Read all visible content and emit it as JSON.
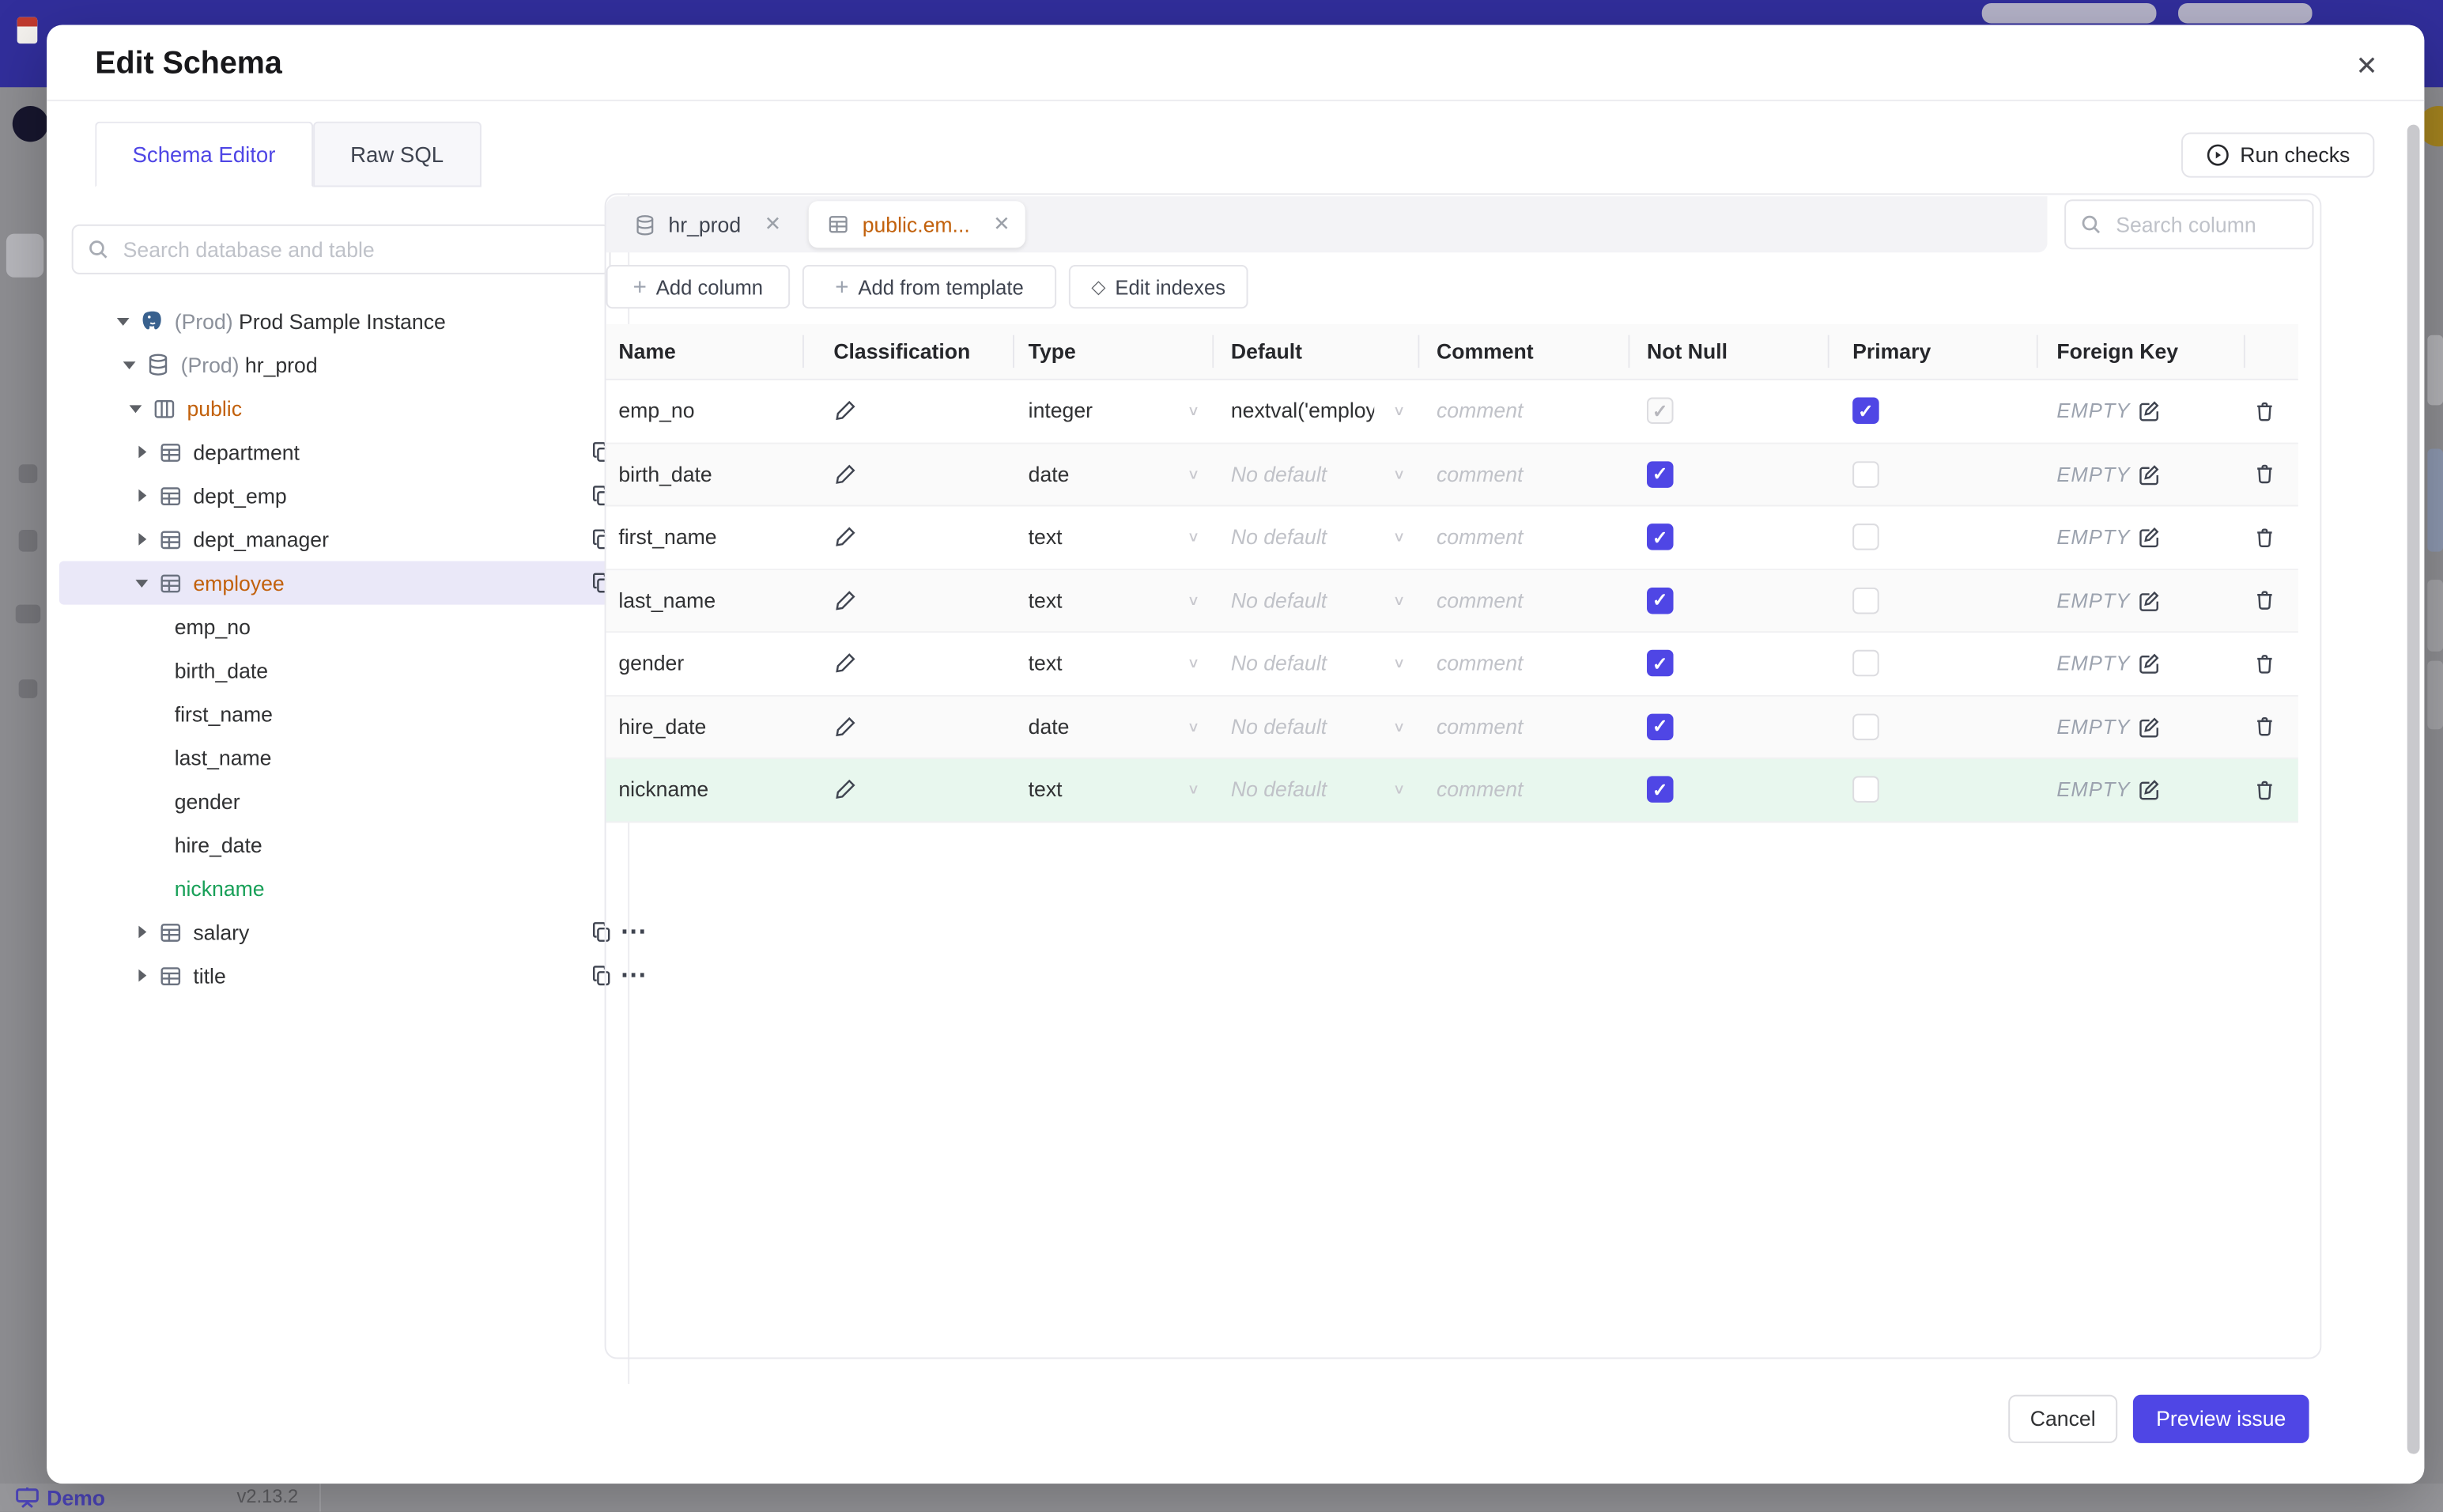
{
  "backdrop": {
    "footer": {
      "brand": "Demo",
      "version": "v2.13.2"
    }
  },
  "modal": {
    "title": "Edit Schema",
    "close_glyph": "✕",
    "run_checks_label": "Run checks",
    "tabs": [
      {
        "label": "Schema Editor",
        "tab_class": "active"
      },
      {
        "label": "Raw SQL",
        "tab_class": ""
      }
    ],
    "sidebar": {
      "search_placeholder": "Search database and table",
      "tree": [
        {
          "level": 0,
          "caret": "down",
          "icon": "elephant",
          "muted": "(Prod) ",
          "label": "Prod Sample Instance",
          "row_class": "",
          "label_class": "",
          "copy": false,
          "dots": false
        },
        {
          "level": 1,
          "caret": "down",
          "icon": "db",
          "muted": "(Prod) ",
          "label": "hr_prod",
          "row_class": "",
          "label_class": "",
          "copy": false,
          "dots": true
        },
        {
          "level": 2,
          "caret": "down",
          "icon": "schema",
          "muted": "",
          "label": "public",
          "row_class": "",
          "label_class": "amber",
          "copy": false,
          "dots": true
        },
        {
          "level": 3,
          "caret": "right",
          "icon": "table",
          "muted": "",
          "label": "department",
          "row_class": "",
          "label_class": "",
          "copy": true,
          "dots": true
        },
        {
          "level": 3,
          "caret": "right",
          "icon": "table",
          "muted": "",
          "label": "dept_emp",
          "row_class": "",
          "label_class": "",
          "copy": true,
          "dots": true
        },
        {
          "level": 3,
          "caret": "right",
          "icon": "table",
          "muted": "",
          "label": "dept_manager",
          "row_class": "",
          "label_class": "",
          "copy": true,
          "dots": true
        },
        {
          "level": 3,
          "caret": "down",
          "icon": "table",
          "muted": "",
          "label": "employee",
          "row_class": "selected",
          "label_class": "amber",
          "copy": true,
          "dots": true
        },
        {
          "level": 4,
          "caret": "",
          "icon": "",
          "muted": "",
          "label": "emp_no",
          "row_class": "",
          "label_class": "",
          "copy": false,
          "dots": false
        },
        {
          "level": 4,
          "caret": "",
          "icon": "",
          "muted": "",
          "label": "birth_date",
          "row_class": "",
          "label_class": "",
          "copy": false,
          "dots": false
        },
        {
          "level": 4,
          "caret": "",
          "icon": "",
          "muted": "",
          "label": "first_name",
          "row_class": "",
          "label_class": "",
          "copy": false,
          "dots": false
        },
        {
          "level": 4,
          "caret": "",
          "icon": "",
          "muted": "",
          "label": "last_name",
          "row_class": "",
          "label_class": "",
          "copy": false,
          "dots": false
        },
        {
          "level": 4,
          "caret": "",
          "icon": "",
          "muted": "",
          "label": "gender",
          "row_class": "",
          "label_class": "",
          "copy": false,
          "dots": false
        },
        {
          "level": 4,
          "caret": "",
          "icon": "",
          "muted": "",
          "label": "hire_date",
          "row_class": "",
          "label_class": "",
          "copy": false,
          "dots": false
        },
        {
          "level": 4,
          "caret": "",
          "icon": "",
          "muted": "",
          "label": "nickname",
          "row_class": "",
          "label_class": "green",
          "copy": false,
          "dots": false
        },
        {
          "level": 3,
          "caret": "right",
          "icon": "table",
          "muted": "",
          "label": "salary",
          "row_class": "",
          "label_class": "",
          "copy": true,
          "dots": true
        },
        {
          "level": 3,
          "caret": "right",
          "icon": "table",
          "muted": "",
          "label": "title",
          "row_class": "",
          "label_class": "",
          "copy": true,
          "dots": true
        }
      ]
    },
    "editor": {
      "tabs": [
        {
          "label": "hr_prod",
          "icon": "db",
          "chip_class": "chip1",
          "close": "✕"
        },
        {
          "label": "public.em...",
          "icon": "table",
          "chip_class": "active",
          "close": "✕"
        }
      ],
      "search_placeholder": "Search column",
      "toolbar": {
        "add_column": "Add column",
        "add_from_template": "Add from template",
        "edit_indexes": "Edit indexes",
        "plus_glyph": "+",
        "diamond_glyph": "◇"
      },
      "table": {
        "headers": [
          "Name",
          "Classification",
          "Type",
          "Default",
          "Comment",
          "Not Null",
          "Primary",
          "Foreign Key",
          ""
        ],
        "comment_placeholder": "comment",
        "fk_empty_label": "EMPTY",
        "rows": [
          {
            "name": "emp_no",
            "type": "integer",
            "default": "nextval('employ",
            "default_class": "val",
            "row_class": "",
            "notnull_class": "checked disabled",
            "primary_class": "checked"
          },
          {
            "name": "birth_date",
            "type": "date",
            "default": "No default",
            "default_class": "ph",
            "row_class": "even",
            "notnull_class": "checked",
            "primary_class": ""
          },
          {
            "name": "first_name",
            "type": "text",
            "default": "No default",
            "default_class": "ph",
            "row_class": "",
            "notnull_class": "checked",
            "primary_class": ""
          },
          {
            "name": "last_name",
            "type": "text",
            "default": "No default",
            "default_class": "ph",
            "row_class": "even",
            "notnull_class": "checked",
            "primary_class": ""
          },
          {
            "name": "gender",
            "type": "text",
            "default": "No default",
            "default_class": "ph",
            "row_class": "",
            "notnull_class": "checked",
            "primary_class": ""
          },
          {
            "name": "hire_date",
            "type": "date",
            "default": "No default",
            "default_class": "ph",
            "row_class": "even",
            "notnull_class": "checked",
            "primary_class": ""
          },
          {
            "name": "nickname",
            "type": "text",
            "default": "No default",
            "default_class": "ph",
            "row_class": "new",
            "notnull_class": "checked",
            "primary_class": ""
          }
        ]
      },
      "footer": {
        "cancel_label": "Cancel",
        "submit_label": "Preview issue"
      }
    }
  }
}
